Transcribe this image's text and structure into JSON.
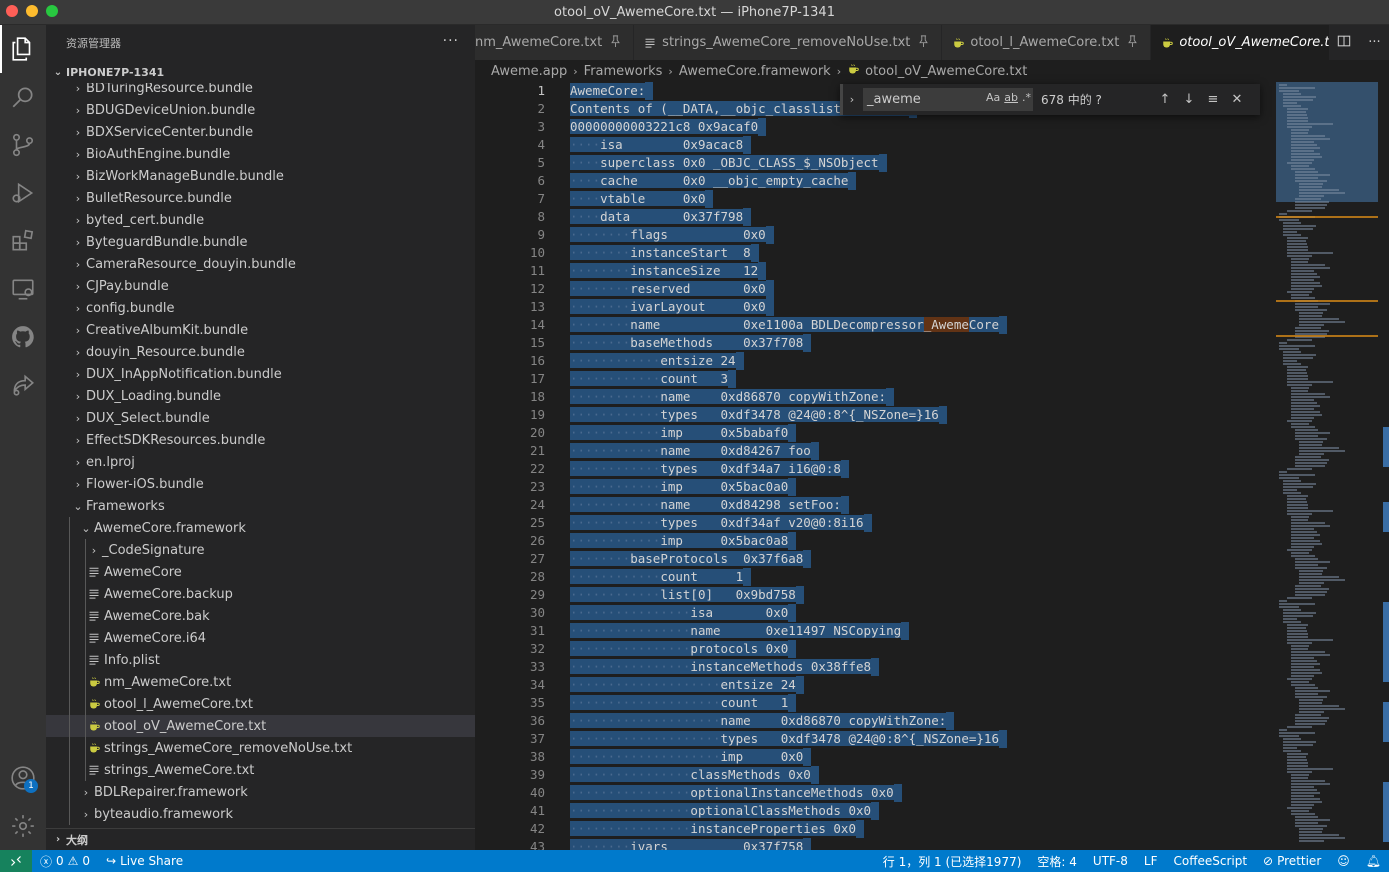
{
  "window": {
    "title": "otool_oV_AwemeCore.txt — iPhone7P-1341"
  },
  "sidebar": {
    "header": "资源管理器",
    "root": "IPHONE7P-1341",
    "outline_label": "大纲",
    "items": [
      {
        "label": "BDTuringResource.bundle",
        "type": "folder",
        "depth": 1,
        "expanded": false
      },
      {
        "label": "BDUGDeviceUnion.bundle",
        "type": "folder",
        "depth": 1,
        "expanded": false
      },
      {
        "label": "BDXServiceCenter.bundle",
        "type": "folder",
        "depth": 1,
        "expanded": false
      },
      {
        "label": "BioAuthEngine.bundle",
        "type": "folder",
        "depth": 1,
        "expanded": false
      },
      {
        "label": "BizWorkManageBundle.bundle",
        "type": "folder",
        "depth": 1,
        "expanded": false
      },
      {
        "label": "BulletResource.bundle",
        "type": "folder",
        "depth": 1,
        "expanded": false
      },
      {
        "label": "byted_cert.bundle",
        "type": "folder",
        "depth": 1,
        "expanded": false
      },
      {
        "label": "ByteguardBundle.bundle",
        "type": "folder",
        "depth": 1,
        "expanded": false
      },
      {
        "label": "CameraResource_douyin.bundle",
        "type": "folder",
        "depth": 1,
        "expanded": false
      },
      {
        "label": "CJPay.bundle",
        "type": "folder",
        "depth": 1,
        "expanded": false
      },
      {
        "label": "config.bundle",
        "type": "folder",
        "depth": 1,
        "expanded": false
      },
      {
        "label": "CreativeAlbumKit.bundle",
        "type": "folder",
        "depth": 1,
        "expanded": false
      },
      {
        "label": "douyin_Resource.bundle",
        "type": "folder",
        "depth": 1,
        "expanded": false
      },
      {
        "label": "DUX_InAppNotification.bundle",
        "type": "folder",
        "depth": 1,
        "expanded": false
      },
      {
        "label": "DUX_Loading.bundle",
        "type": "folder",
        "depth": 1,
        "expanded": false
      },
      {
        "label": "DUX_Select.bundle",
        "type": "folder",
        "depth": 1,
        "expanded": false
      },
      {
        "label": "EffectSDKResources.bundle",
        "type": "folder",
        "depth": 1,
        "expanded": false
      },
      {
        "label": "en.lproj",
        "type": "folder",
        "depth": 1,
        "expanded": false
      },
      {
        "label": "Flower-iOS.bundle",
        "type": "folder",
        "depth": 1,
        "expanded": false
      },
      {
        "label": "Frameworks",
        "type": "folder",
        "depth": 1,
        "expanded": true
      },
      {
        "label": "AwemeCore.framework",
        "type": "folder",
        "depth": 2,
        "expanded": true
      },
      {
        "label": "_CodeSignature",
        "type": "folder",
        "depth": 3,
        "expanded": false
      },
      {
        "label": "AwemeCore",
        "type": "file-lines",
        "depth": 3
      },
      {
        "label": "AwemeCore.backup",
        "type": "file-lines",
        "depth": 3
      },
      {
        "label": "AwemeCore.bak",
        "type": "file-lines",
        "depth": 3
      },
      {
        "label": "AwemeCore.i64",
        "type": "file-lines",
        "depth": 3
      },
      {
        "label": "Info.plist",
        "type": "file-lines",
        "depth": 3
      },
      {
        "label": "nm_AwemeCore.txt",
        "type": "file-coffee",
        "depth": 3
      },
      {
        "label": "otool_l_AwemeCore.txt",
        "type": "file-coffee",
        "depth": 3
      },
      {
        "label": "otool_oV_AwemeCore.txt",
        "type": "file-coffee",
        "depth": 3,
        "selected": true
      },
      {
        "label": "strings_AwemeCore_removeNoUse.txt",
        "type": "file-coffee",
        "depth": 3
      },
      {
        "label": "strings_AwemeCore.txt",
        "type": "file-lines",
        "depth": 3
      },
      {
        "label": "BDLRepairer.framework",
        "type": "folder",
        "depth": 2,
        "expanded": false
      },
      {
        "label": "byteaudio.framework",
        "type": "folder",
        "depth": 2,
        "expanded": false
      }
    ]
  },
  "activity_bar": {
    "icons": [
      "explorer-icon",
      "search-icon",
      "source-control-icon",
      "run-debug-icon",
      "extensions-icon",
      "remote-explorer-icon",
      "github-icon",
      "live-share-icon"
    ],
    "bottom_icons": [
      "account-icon",
      "settings-gear-icon"
    ],
    "account_badge": "1"
  },
  "tabs": [
    {
      "label": "nm_AwemeCore.txt",
      "icon": "file-coffee-icon",
      "pinned": true,
      "active": false
    },
    {
      "label": "strings_AwemeCore_removeNoUse.txt",
      "icon": "file-lines-icon",
      "pinned": true,
      "active": false
    },
    {
      "label": "otool_l_AwemeCore.txt",
      "icon": "file-coffee-icon",
      "pinned": true,
      "active": false
    },
    {
      "label": "otool_oV_AwemeCore.txt",
      "icon": "file-coffee-icon",
      "pinned": false,
      "active": true
    }
  ],
  "breadcrumb": {
    "parts": [
      "Aweme.app",
      "Frameworks",
      "AwemeCore.framework",
      "otool_oV_AwemeCore.txt"
    ]
  },
  "find_widget": {
    "query": "_aweme",
    "match_case": "Aa",
    "whole_word": "ab",
    "regex": ".*",
    "result": "678 中的 ?"
  },
  "editor": {
    "current_line": 1,
    "lines": [
      {
        "n": "1",
        "indent": 0,
        "text": "AwemeCore:"
      },
      {
        "n": "2",
        "indent": 0,
        "text": "Contents of (__DATA,__objc_classlist) section"
      },
      {
        "n": "3",
        "indent": 0,
        "text": "00000000003221c8 0x9acaf0"
      },
      {
        "n": "4",
        "indent": 1,
        "text": "isa        0x9acac8"
      },
      {
        "n": "5",
        "indent": 1,
        "text": "superclass 0x0 _OBJC_CLASS_$_NSObject"
      },
      {
        "n": "6",
        "indent": 1,
        "text": "cache      0x0 __objc_empty_cache"
      },
      {
        "n": "7",
        "indent": 1,
        "text": "vtable     0x0"
      },
      {
        "n": "8",
        "indent": 1,
        "text": "data       0x37f798"
      },
      {
        "n": "9",
        "indent": 2,
        "text": "flags          0x0"
      },
      {
        "n": "10",
        "indent": 2,
        "text": "instanceStart  8"
      },
      {
        "n": "11",
        "indent": 2,
        "text": "instanceSize   12"
      },
      {
        "n": "12",
        "indent": 2,
        "text": "reserved       0x0"
      },
      {
        "n": "13",
        "indent": 2,
        "text": "ivarLayout     0x0"
      },
      {
        "n": "14",
        "indent": 2,
        "text": "name           0xe1100a BDLDecompressor_AwemeCore",
        "hit": "_Aweme"
      },
      {
        "n": "15",
        "indent": 2,
        "text": "baseMethods    0x37f708"
      },
      {
        "n": "16",
        "indent": 3,
        "text": "entsize 24"
      },
      {
        "n": "17",
        "indent": 3,
        "text": "count   3"
      },
      {
        "n": "18",
        "indent": 3,
        "text": "name    0xd86870 copyWithZone:"
      },
      {
        "n": "19",
        "indent": 3,
        "text": "types   0xdf3478 @24@0:8^{_NSZone=}16"
      },
      {
        "n": "20",
        "indent": 3,
        "text": "imp     0x5babaf0"
      },
      {
        "n": "21",
        "indent": 3,
        "text": "name    0xd84267 foo"
      },
      {
        "n": "22",
        "indent": 3,
        "text": "types   0xdf34a7 i16@0:8"
      },
      {
        "n": "23",
        "indent": 3,
        "text": "imp     0x5bac0a0"
      },
      {
        "n": "24",
        "indent": 3,
        "text": "name    0xd84298 setFoo:"
      },
      {
        "n": "25",
        "indent": 3,
        "text": "types   0xdf34af v20@0:8i16"
      },
      {
        "n": "26",
        "indent": 3,
        "text": "imp     0x5bac0a8"
      },
      {
        "n": "27",
        "indent": 2,
        "text": "baseProtocols  0x37f6a8"
      },
      {
        "n": "28",
        "indent": 3,
        "text": "count     1"
      },
      {
        "n": "29",
        "indent": 3,
        "text": "list[0]   0x9bd758"
      },
      {
        "n": "30",
        "indent": 4,
        "text": "isa       0x0"
      },
      {
        "n": "31",
        "indent": 4,
        "text": "name      0xe11497 NSCopying"
      },
      {
        "n": "32",
        "indent": 4,
        "text": "protocols 0x0"
      },
      {
        "n": "33",
        "indent": 4,
        "text": "instanceMethods 0x38ffe8"
      },
      {
        "n": "34",
        "indent": 5,
        "text": "entsize 24"
      },
      {
        "n": "35",
        "indent": 5,
        "text": "count   1"
      },
      {
        "n": "36",
        "indent": 5,
        "text": "name    0xd86870 copyWithZone:"
      },
      {
        "n": "37",
        "indent": 5,
        "text": "types   0xdf3478 @24@0:8^{_NSZone=}16"
      },
      {
        "n": "38",
        "indent": 5,
        "text": "imp     0x0"
      },
      {
        "n": "39",
        "indent": 4,
        "text": "classMethods 0x0"
      },
      {
        "n": "40",
        "indent": 4,
        "text": "optionalInstanceMethods 0x0"
      },
      {
        "n": "41",
        "indent": 4,
        "text": "optionalClassMethods 0x0"
      },
      {
        "n": "42",
        "indent": 4,
        "text": "instanceProperties 0x0"
      },
      {
        "n": "43",
        "indent": 2,
        "text": "ivars          0x37f758"
      }
    ]
  },
  "status_bar": {
    "errors": "0",
    "warnings": "0",
    "live_share": "Live Share",
    "position": "行 1，列 1 (已选择1977)",
    "spaces": "空格: 4",
    "encoding": "UTF-8",
    "eol": "LF",
    "language": "CoffeeScript",
    "formatter": "Prettier"
  },
  "colors": {
    "accent": "#007acc",
    "selection": "#264f78",
    "find_match": "#623315",
    "coffee_icon": "#cbcb41"
  }
}
